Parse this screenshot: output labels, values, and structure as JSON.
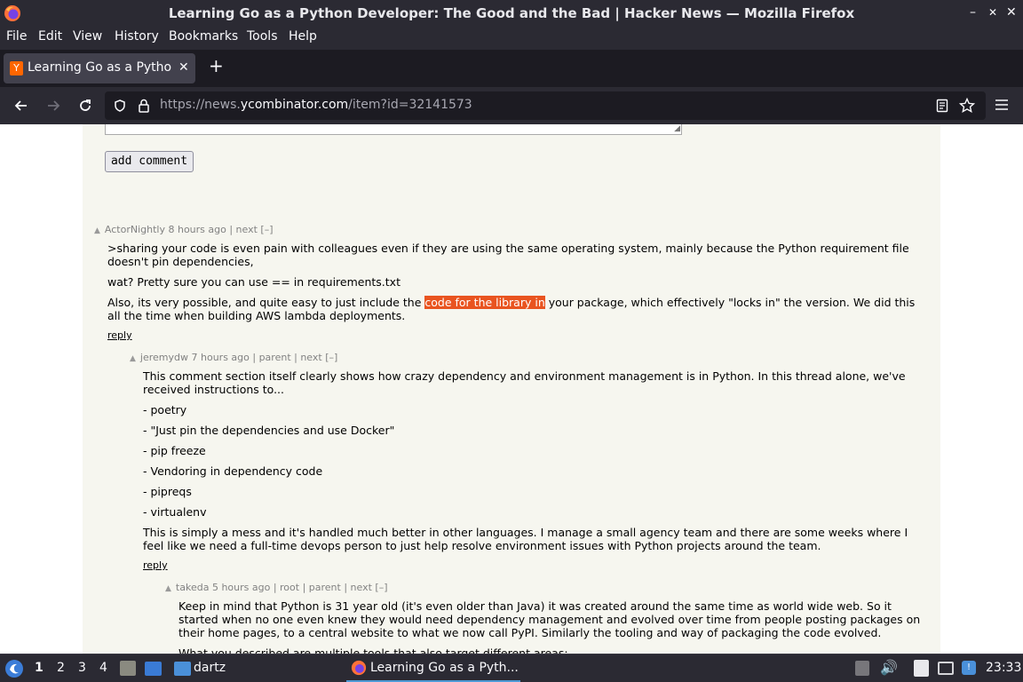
{
  "window": {
    "title": "Learning Go as a Python Developer: The Good and the Bad | Hacker News — Mozilla Firefox",
    "minimize": "–",
    "maximize": "✕",
    "close": "✕"
  },
  "menu": [
    "File",
    "Edit",
    "View",
    "History",
    "Bookmarks",
    "Tools",
    "Help"
  ],
  "tab": {
    "favicon": "Y",
    "title": "Learning Go as a Python Developer",
    "close": "✕",
    "new_tab": "+"
  },
  "nav": {
    "url_prefix": "https://news.",
    "url_domain": "ycombinator.com",
    "url_suffix": "/item?id=32141573"
  },
  "form": {
    "add_comment": "add comment"
  },
  "comments": [
    {
      "user": "ActorNightly",
      "age": "8 hours ago",
      "links": " | next [–]",
      "paragraphs": [
        ">sharing your code is even pain with colleagues even if they are using the same operating system, mainly because the Python requirement file doesn't pin dependencies,",
        "wat? Pretty sure you can use == in requirements.txt"
      ],
      "p3_before": "Also, its very possible, and quite easy to just include the ",
      "p3_highlight": "code for the library in",
      "p3_after": " your package, which effectively \"locks in\" the version. We did this all the time when building AWS lambda deployments.",
      "reply": "reply"
    },
    {
      "user": "jeremydw",
      "age": "7 hours ago",
      "links": " | parent | next [–]",
      "paragraphs": [
        "This comment section itself clearly shows how crazy dependency and environment management is in Python. In this thread alone, we've received instructions to...",
        "- poetry",
        "- \"Just pin the dependencies and use Docker\"",
        "- pip freeze",
        "- Vendoring in dependency code",
        "- pipreqs",
        "- virtualenv",
        "This is simply a mess and it's handled much better in other languages. I manage a small agency team and there are some weeks where I feel like we need a full-time devops person to just help resolve environment issues with Python projects around the team."
      ],
      "reply": "reply"
    },
    {
      "user": "takeda",
      "age": "5 hours ago",
      "links": " | root | parent | next [–]",
      "paragraphs": [
        "Keep in mind that Python is 31 year old (it's even older than Java) it was created around the same time as world wide web. So it started when no one even knew they would need dependency management and evolved over time from people posting packages on their home pages, to a central website to what we now call PyPI. Similarly the tooling and way of packaging the code evolved.",
        "What you described are multiple tools that also target different areas:"
      ]
    }
  ],
  "taskbar": {
    "workspaces": [
      "1",
      "2",
      "3",
      "4"
    ],
    "folder_label": "dartz",
    "task_label": "Learning Go as a Pyth...",
    "clock": "23:33"
  },
  "icons": {
    "back": "arrow-left-icon",
    "forward": "arrow-right-icon",
    "reload": "reload-icon",
    "shield": "shield-icon",
    "lock": "lock-icon",
    "reader": "reader-view-icon",
    "bookmark": "star-icon",
    "menu": "hamburger-menu-icon"
  }
}
